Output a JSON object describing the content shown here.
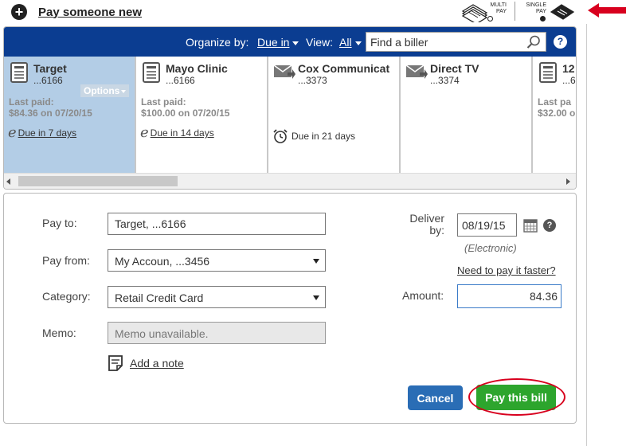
{
  "top": {
    "pay_new_label": "Pay someone new",
    "multi_pay_label_1": "MULTI",
    "multi_pay_label_2": "PAY",
    "single_pay_label_1": "SINGLE",
    "single_pay_label_2": "PAY",
    "selected_mode": "single",
    "annotation_color": "#d8001e"
  },
  "header": {
    "organize_label": "Organize by:",
    "organize_value": "Due in",
    "view_label": "View:",
    "view_value": "All",
    "search_placeholder": "Find a biller",
    "help_label": "?",
    "bg_color": "#0b3d91"
  },
  "billers": [
    {
      "name": "Target",
      "account": "...6166",
      "options_label": "Options",
      "last_paid_label": "Last paid:",
      "last_paid_value": "$84.36 on 07/20/15",
      "due": "Due in 7 days",
      "icon": "document-icon",
      "due_icon": "ebill-icon",
      "selected": true
    },
    {
      "name": "Mayo Clinic",
      "account": "...6166",
      "last_paid_label": "Last paid:",
      "last_paid_value": "$100.00 on 07/20/15",
      "due": "Due in 14 days",
      "icon": "document-icon",
      "due_icon": "ebill-icon",
      "selected": false
    },
    {
      "name": "Cox Communicat",
      "account": "...3373",
      "due": "Due in 21 days",
      "icon": "envelope-icon",
      "due_icon": "alarm-clock-icon",
      "selected": false
    },
    {
      "name": "Direct TV",
      "account": "...3374",
      "icon": "envelope-icon",
      "selected": false
    },
    {
      "name": "12",
      "account": "...6",
      "last_paid_label": "Last pa",
      "last_paid_value": "$32.00 o",
      "icon": "document-icon",
      "selected": false
    }
  ],
  "form": {
    "pay_to_label": "Pay to:",
    "pay_to_value": "Target, ...6166",
    "pay_from_label": "Pay from:",
    "pay_from_value": "My Accoun, ...3456",
    "category_label": "Category:",
    "category_value": "Retail Credit Card",
    "memo_label": "Memo:",
    "memo_value": "Memo unavailable.",
    "add_note_label": "Add a note",
    "deliver_label_1": "Deliver",
    "deliver_label_2": "by:",
    "deliver_value": "08/19/15",
    "delivery_method": "(Electronic)",
    "need_faster_label": "Need to pay it faster?",
    "amount_label": "Amount:",
    "amount_value": "84.36",
    "help_label": "?",
    "cancel_label": "Cancel",
    "pay_label": "Pay this bill",
    "cancel_color": "#2a6db5",
    "pay_color": "#2da52d"
  }
}
